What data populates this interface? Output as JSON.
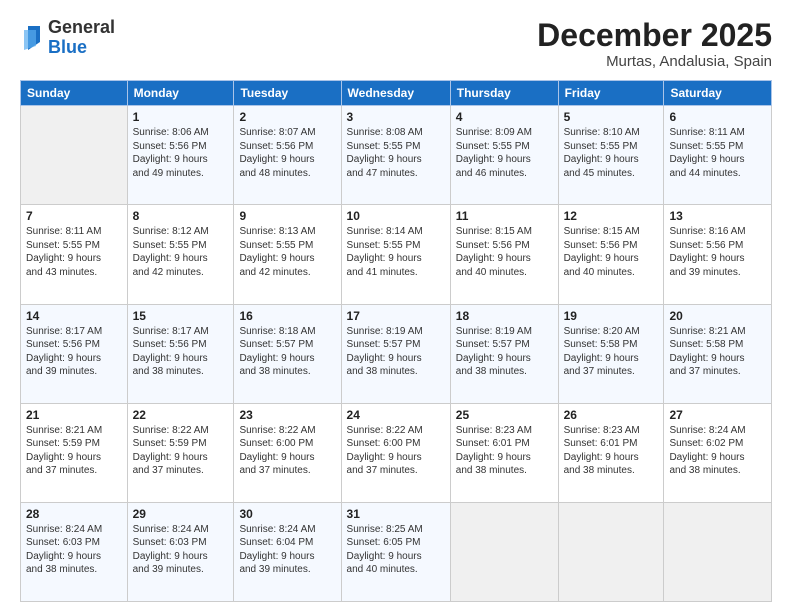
{
  "header": {
    "logo": {
      "general": "General",
      "blue": "Blue"
    },
    "month": "December 2025",
    "location": "Murtas, Andalusia, Spain"
  },
  "weekdays": [
    "Sunday",
    "Monday",
    "Tuesday",
    "Wednesday",
    "Thursday",
    "Friday",
    "Saturday"
  ],
  "weeks": [
    [
      {
        "day": "",
        "info": ""
      },
      {
        "day": "1",
        "info": "Sunrise: 8:06 AM\nSunset: 5:56 PM\nDaylight: 9 hours\nand 49 minutes."
      },
      {
        "day": "2",
        "info": "Sunrise: 8:07 AM\nSunset: 5:56 PM\nDaylight: 9 hours\nand 48 minutes."
      },
      {
        "day": "3",
        "info": "Sunrise: 8:08 AM\nSunset: 5:55 PM\nDaylight: 9 hours\nand 47 minutes."
      },
      {
        "day": "4",
        "info": "Sunrise: 8:09 AM\nSunset: 5:55 PM\nDaylight: 9 hours\nand 46 minutes."
      },
      {
        "day": "5",
        "info": "Sunrise: 8:10 AM\nSunset: 5:55 PM\nDaylight: 9 hours\nand 45 minutes."
      },
      {
        "day": "6",
        "info": "Sunrise: 8:11 AM\nSunset: 5:55 PM\nDaylight: 9 hours\nand 44 minutes."
      }
    ],
    [
      {
        "day": "7",
        "info": ""
      },
      {
        "day": "8",
        "info": "Sunrise: 8:12 AM\nSunset: 5:55 PM\nDaylight: 9 hours\nand 42 minutes."
      },
      {
        "day": "9",
        "info": "Sunrise: 8:13 AM\nSunset: 5:55 PM\nDaylight: 9 hours\nand 42 minutes."
      },
      {
        "day": "10",
        "info": "Sunrise: 8:14 AM\nSunset: 5:55 PM\nDaylight: 9 hours\nand 41 minutes."
      },
      {
        "day": "11",
        "info": "Sunrise: 8:15 AM\nSunset: 5:56 PM\nDaylight: 9 hours\nand 40 minutes."
      },
      {
        "day": "12",
        "info": "Sunrise: 8:15 AM\nSunset: 5:56 PM\nDaylight: 9 hours\nand 40 minutes."
      },
      {
        "day": "13",
        "info": "Sunrise: 8:16 AM\nSunset: 5:56 PM\nDaylight: 9 hours\nand 39 minutes."
      }
    ],
    [
      {
        "day": "14",
        "info": ""
      },
      {
        "day": "15",
        "info": "Sunrise: 8:17 AM\nSunset: 5:56 PM\nDaylight: 9 hours\nand 38 minutes."
      },
      {
        "day": "16",
        "info": "Sunrise: 8:18 AM\nSunset: 5:57 PM\nDaylight: 9 hours\nand 38 minutes."
      },
      {
        "day": "17",
        "info": "Sunrise: 8:19 AM\nSunset: 5:57 PM\nDaylight: 9 hours\nand 38 minutes."
      },
      {
        "day": "18",
        "info": "Sunrise: 8:19 AM\nSunset: 5:57 PM\nDaylight: 9 hours\nand 38 minutes."
      },
      {
        "day": "19",
        "info": "Sunrise: 8:20 AM\nSunset: 5:58 PM\nDaylight: 9 hours\nand 37 minutes."
      },
      {
        "day": "20",
        "info": "Sunrise: 8:21 AM\nSunset: 5:58 PM\nDaylight: 9 hours\nand 37 minutes."
      }
    ],
    [
      {
        "day": "21",
        "info": "Sunrise: 8:21 AM\nSunset: 5:59 PM\nDaylight: 9 hours\nand 37 minutes."
      },
      {
        "day": "22",
        "info": "Sunrise: 8:22 AM\nSunset: 5:59 PM\nDaylight: 9 hours\nand 37 minutes."
      },
      {
        "day": "23",
        "info": "Sunrise: 8:22 AM\nSunset: 6:00 PM\nDaylight: 9 hours\nand 37 minutes."
      },
      {
        "day": "24",
        "info": "Sunrise: 8:22 AM\nSunset: 6:00 PM\nDaylight: 9 hours\nand 37 minutes."
      },
      {
        "day": "25",
        "info": "Sunrise: 8:23 AM\nSunset: 6:01 PM\nDaylight: 9 hours\nand 38 minutes."
      },
      {
        "day": "26",
        "info": "Sunrise: 8:23 AM\nSunset: 6:01 PM\nDaylight: 9 hours\nand 38 minutes."
      },
      {
        "day": "27",
        "info": "Sunrise: 8:24 AM\nSunset: 6:02 PM\nDaylight: 9 hours\nand 38 minutes."
      }
    ],
    [
      {
        "day": "28",
        "info": "Sunrise: 8:24 AM\nSunset: 6:03 PM\nDaylight: 9 hours\nand 38 minutes."
      },
      {
        "day": "29",
        "info": "Sunrise: 8:24 AM\nSunset: 6:03 PM\nDaylight: 9 hours\nand 39 minutes."
      },
      {
        "day": "30",
        "info": "Sunrise: 8:24 AM\nSunset: 6:04 PM\nDaylight: 9 hours\nand 39 minutes."
      },
      {
        "day": "31",
        "info": "Sunrise: 8:25 AM\nSunset: 6:05 PM\nDaylight: 9 hours\nand 40 minutes."
      },
      {
        "day": "",
        "info": ""
      },
      {
        "day": "",
        "info": ""
      },
      {
        "day": "",
        "info": ""
      }
    ]
  ],
  "week7_sunday": "Sunrise: 8:11 AM\nSunset: 5:55 PM\nDaylight: 9 hours\nand 43 minutes.",
  "week14_sunday": "Sunrise: 8:17 AM\nSunset: 5:56 PM\nDaylight: 9 hours\nand 39 minutes."
}
